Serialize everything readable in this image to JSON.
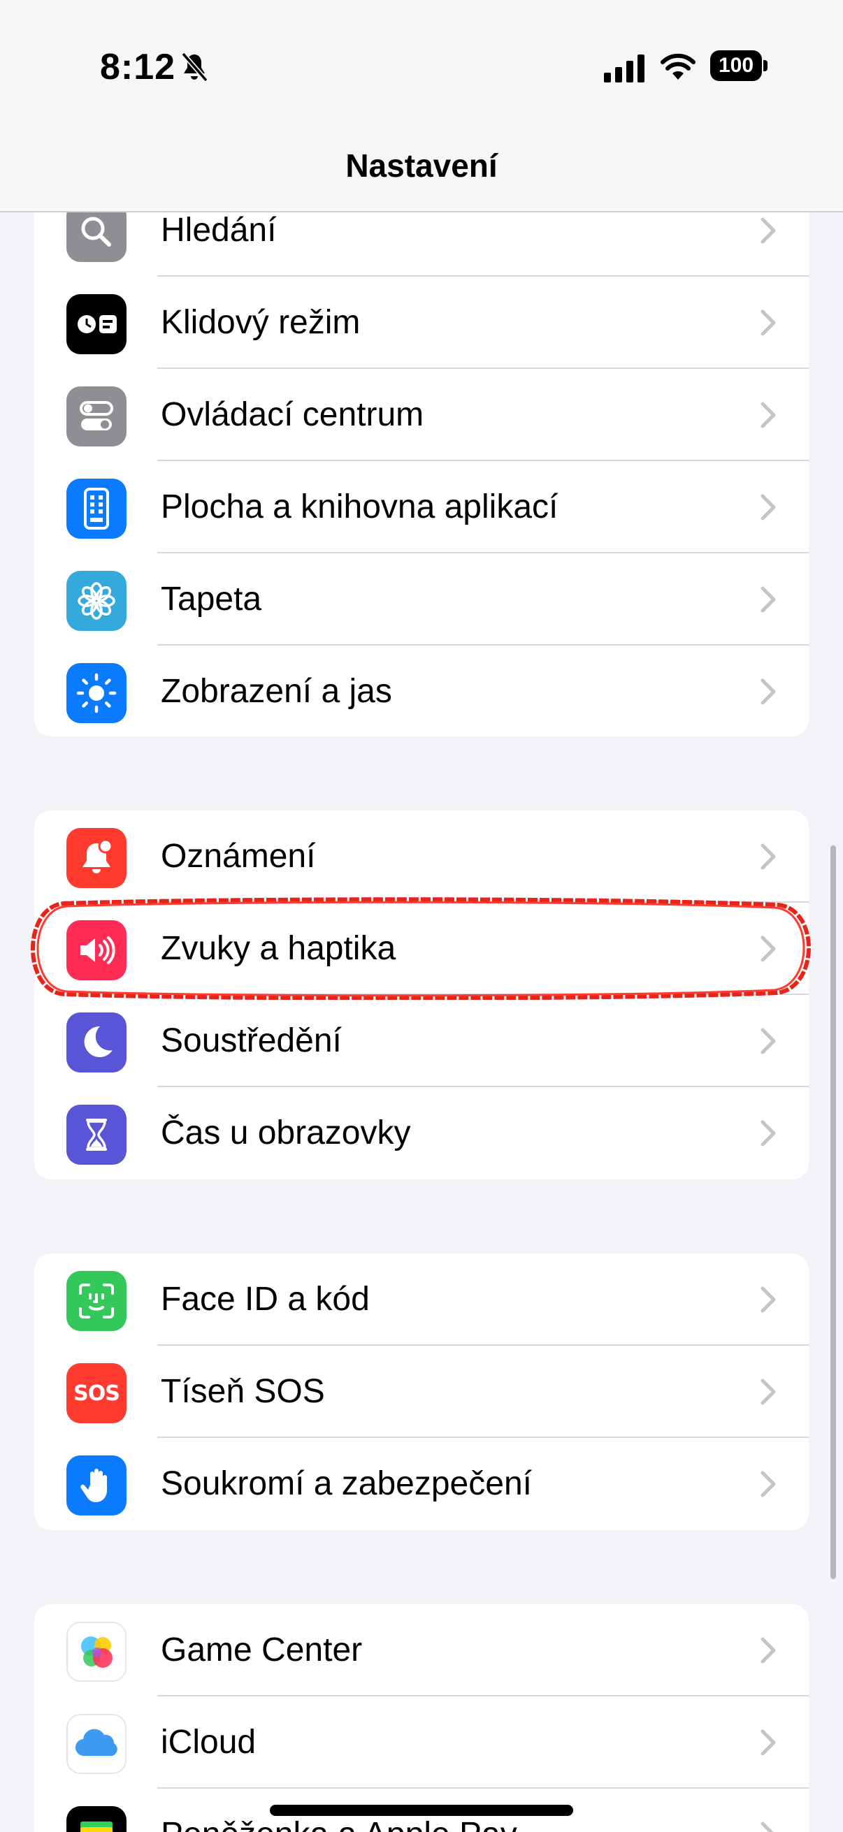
{
  "status_bar": {
    "time": "8:12",
    "battery": "100"
  },
  "nav": {
    "title": "Nastavení"
  },
  "groups": [
    {
      "items": [
        {
          "label": "Hledání",
          "icon": "search-icon",
          "color": "#8e8e93"
        },
        {
          "label": "Klidový režim",
          "icon": "standby-icon",
          "color": "#000000"
        },
        {
          "label": "Ovládací centrum",
          "icon": "toggles-icon",
          "color": "#8e8e93"
        },
        {
          "label": "Plocha a knihovna aplikací",
          "icon": "homescreen-icon",
          "color": "#0a7aff"
        },
        {
          "label": "Tapeta",
          "icon": "flower-icon",
          "color": "#34aadc"
        },
        {
          "label": "Zobrazení a jas",
          "icon": "sun-icon",
          "color": "#0a7aff"
        }
      ]
    },
    {
      "items": [
        {
          "label": "Oznámení",
          "icon": "bell-icon",
          "color": "#ff3b30"
        },
        {
          "label": "Zvuky a haptika",
          "icon": "speaker-icon",
          "color": "#ff2d55",
          "highlighted": true
        },
        {
          "label": "Soustředění",
          "icon": "moon-icon",
          "color": "#5856d6"
        },
        {
          "label": "Čas u obrazovky",
          "icon": "hourglass-icon",
          "color": "#5856d6"
        }
      ]
    },
    {
      "items": [
        {
          "label": "Face ID a kód",
          "icon": "faceid-icon",
          "color": "#34c759"
        },
        {
          "label": "Tíseň SOS",
          "icon": "sos-icon",
          "color": "#ff3b30",
          "icon_text": "SOS"
        },
        {
          "label": "Soukromí a zabezpečení",
          "icon": "hand-icon",
          "color": "#0a7aff"
        }
      ]
    },
    {
      "items": [
        {
          "label": "Game Center",
          "icon": "gamecenter-icon",
          "color": "#ffffff"
        },
        {
          "label": "iCloud",
          "icon": "icloud-icon",
          "color": "#ffffff"
        },
        {
          "label": "Peněženka a Apple Pay",
          "icon": "wallet-icon",
          "color": "#000000"
        }
      ]
    }
  ]
}
